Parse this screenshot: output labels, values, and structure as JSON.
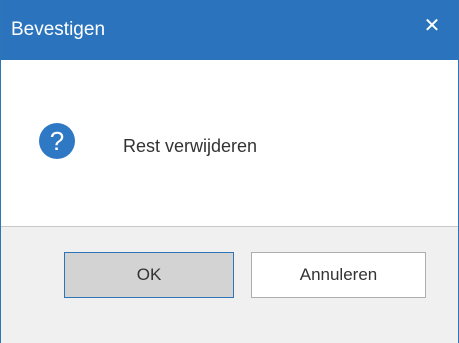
{
  "dialog": {
    "title": "Bevestigen",
    "close_glyph": "✕",
    "message": "Rest verwijderen",
    "icon": "question-icon",
    "buttons": {
      "ok_label": "OK",
      "cancel_label": "Annuleren"
    }
  },
  "colors": {
    "titlebar": "#2b74bd",
    "icon_fill": "#2f78c4",
    "ok_border": "#2e75b8",
    "footer_bg": "#f0f0f0"
  }
}
